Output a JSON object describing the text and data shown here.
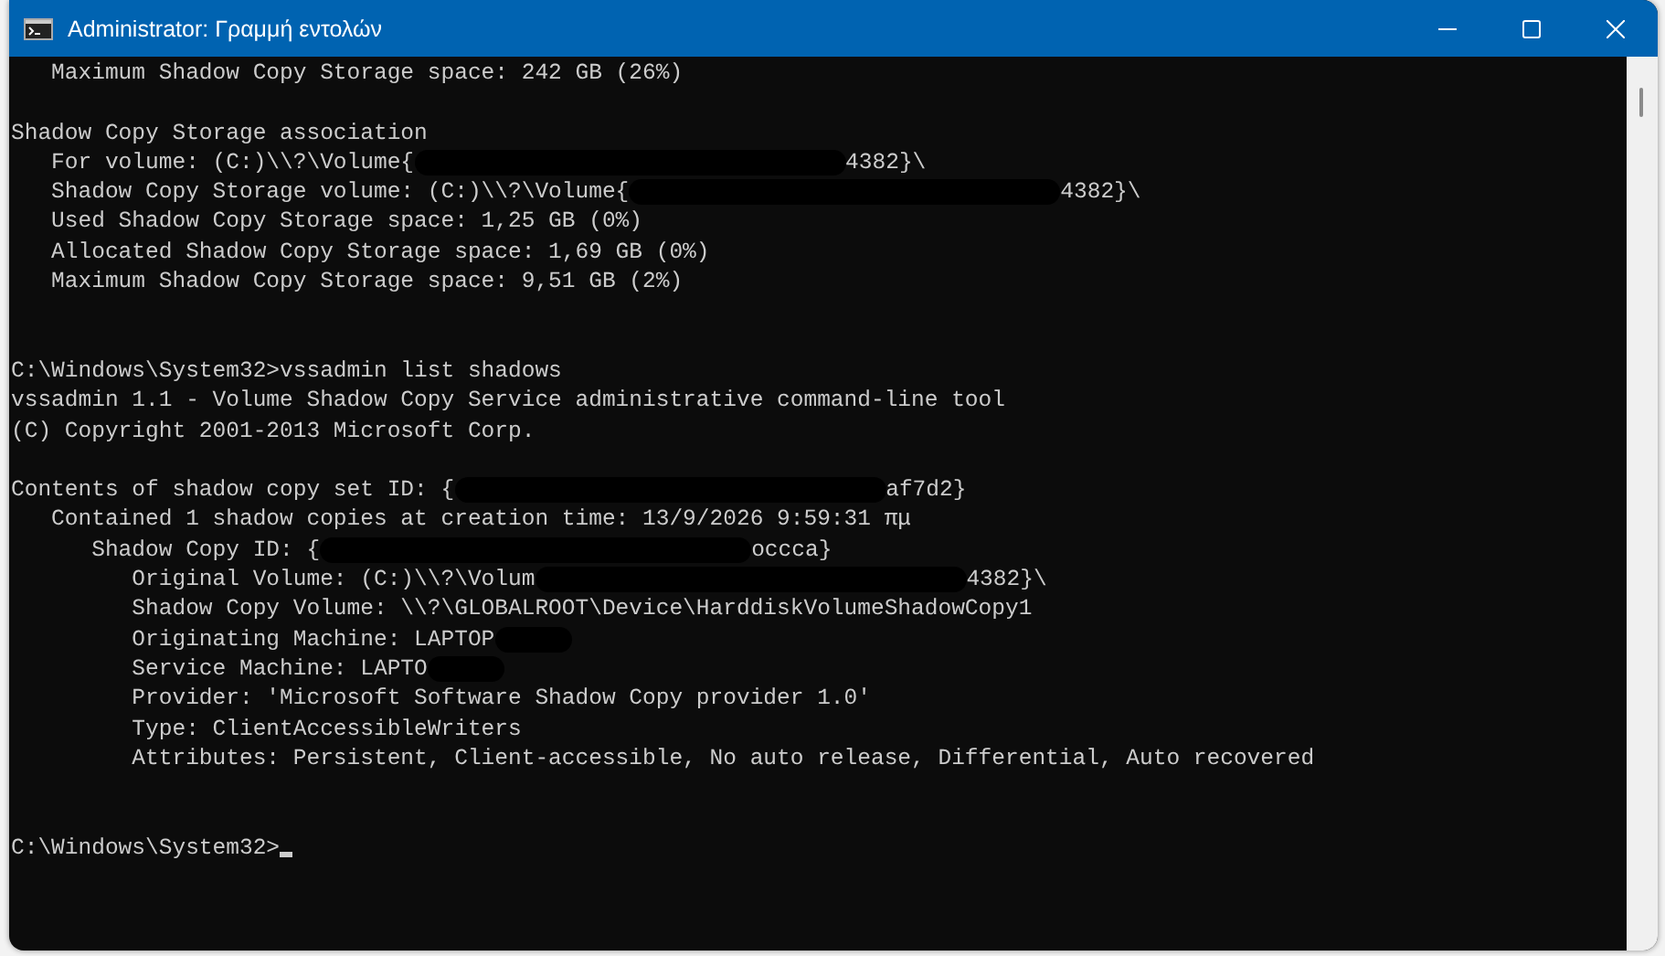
{
  "window": {
    "title": "Administrator: Γραμμή εντολών"
  },
  "console": {
    "lines": [
      {
        "kind": "text",
        "text": "   Maximum Shadow Copy Storage space: 242 GB (26%)"
      },
      {
        "kind": "blank"
      },
      {
        "kind": "text",
        "text": "Shadow Copy Storage association"
      },
      {
        "kind": "redacted",
        "parts": [
          {
            "kind": "text",
            "text": "   For volume: (C:)\\\\?\\Volume{"
          },
          {
            "kind": "redaction"
          },
          {
            "kind": "text",
            "text": "4382}\\"
          }
        ]
      },
      {
        "kind": "redacted",
        "parts": [
          {
            "kind": "text",
            "text": "   Shadow Copy Storage volume: (C:)\\\\?\\Volume{"
          },
          {
            "kind": "redaction"
          },
          {
            "kind": "text",
            "text": "4382}\\"
          }
        ]
      },
      {
        "kind": "text",
        "text": "   Used Shadow Copy Storage space: 1,25 GB (0%)"
      },
      {
        "kind": "text",
        "text": "   Allocated Shadow Copy Storage space: 1,69 GB (0%)"
      },
      {
        "kind": "text",
        "text": "   Maximum Shadow Copy Storage space: 9,51 GB (2%)"
      },
      {
        "kind": "blank"
      },
      {
        "kind": "blank"
      },
      {
        "kind": "text",
        "text": "C:\\Windows\\System32>vssadmin list shadows"
      },
      {
        "kind": "text",
        "text": "vssadmin 1.1 - Volume Shadow Copy Service administrative command-line tool"
      },
      {
        "kind": "text",
        "text": "(C) Copyright 2001-2013 Microsoft Corp."
      },
      {
        "kind": "blank"
      },
      {
        "kind": "redacted",
        "parts": [
          {
            "kind": "text",
            "text": "Contents of shadow copy set ID: {"
          },
          {
            "kind": "redaction"
          },
          {
            "kind": "text",
            "text": "af7d2}"
          }
        ]
      },
      {
        "kind": "text",
        "text": "   Contained 1 shadow copies at creation time: 13/9/2026 9:59:31 πμ"
      },
      {
        "kind": "redacted",
        "parts": [
          {
            "kind": "text",
            "text": "      Shadow Copy ID: {"
          },
          {
            "kind": "redaction"
          },
          {
            "kind": "text",
            "text": "occca}"
          }
        ]
      },
      {
        "kind": "redacted",
        "parts": [
          {
            "kind": "text",
            "text": "         Original Volume: (C:)\\\\?\\Volum"
          },
          {
            "kind": "redaction"
          },
          {
            "kind": "text",
            "text": "4382}\\"
          }
        ]
      },
      {
        "kind": "text",
        "text": "         Shadow Copy Volume: \\\\?\\GLOBALROOT\\Device\\HarddiskVolumeShadowCopy1"
      },
      {
        "kind": "redacted",
        "parts": [
          {
            "kind": "text",
            "text": "         Originating Machine: LAPTOP"
          },
          {
            "kind": "short_redaction"
          }
        ]
      },
      {
        "kind": "redacted",
        "parts": [
          {
            "kind": "text",
            "text": "         Service Machine: LAPTO"
          },
          {
            "kind": "short_redaction"
          }
        ]
      },
      {
        "kind": "text",
        "text": "         Provider: 'Microsoft Software Shadow Copy provider 1.0'"
      },
      {
        "kind": "text",
        "text": "         Type: ClientAccessibleWriters"
      },
      {
        "kind": "text",
        "text": "         Attributes: Persistent, Client-accessible, No auto release, Differential, Auto recovered"
      },
      {
        "kind": "blank"
      },
      {
        "kind": "blank"
      },
      {
        "kind": "prompt",
        "text": "C:\\Windows\\System32>",
        "cursor": true
      }
    ]
  }
}
